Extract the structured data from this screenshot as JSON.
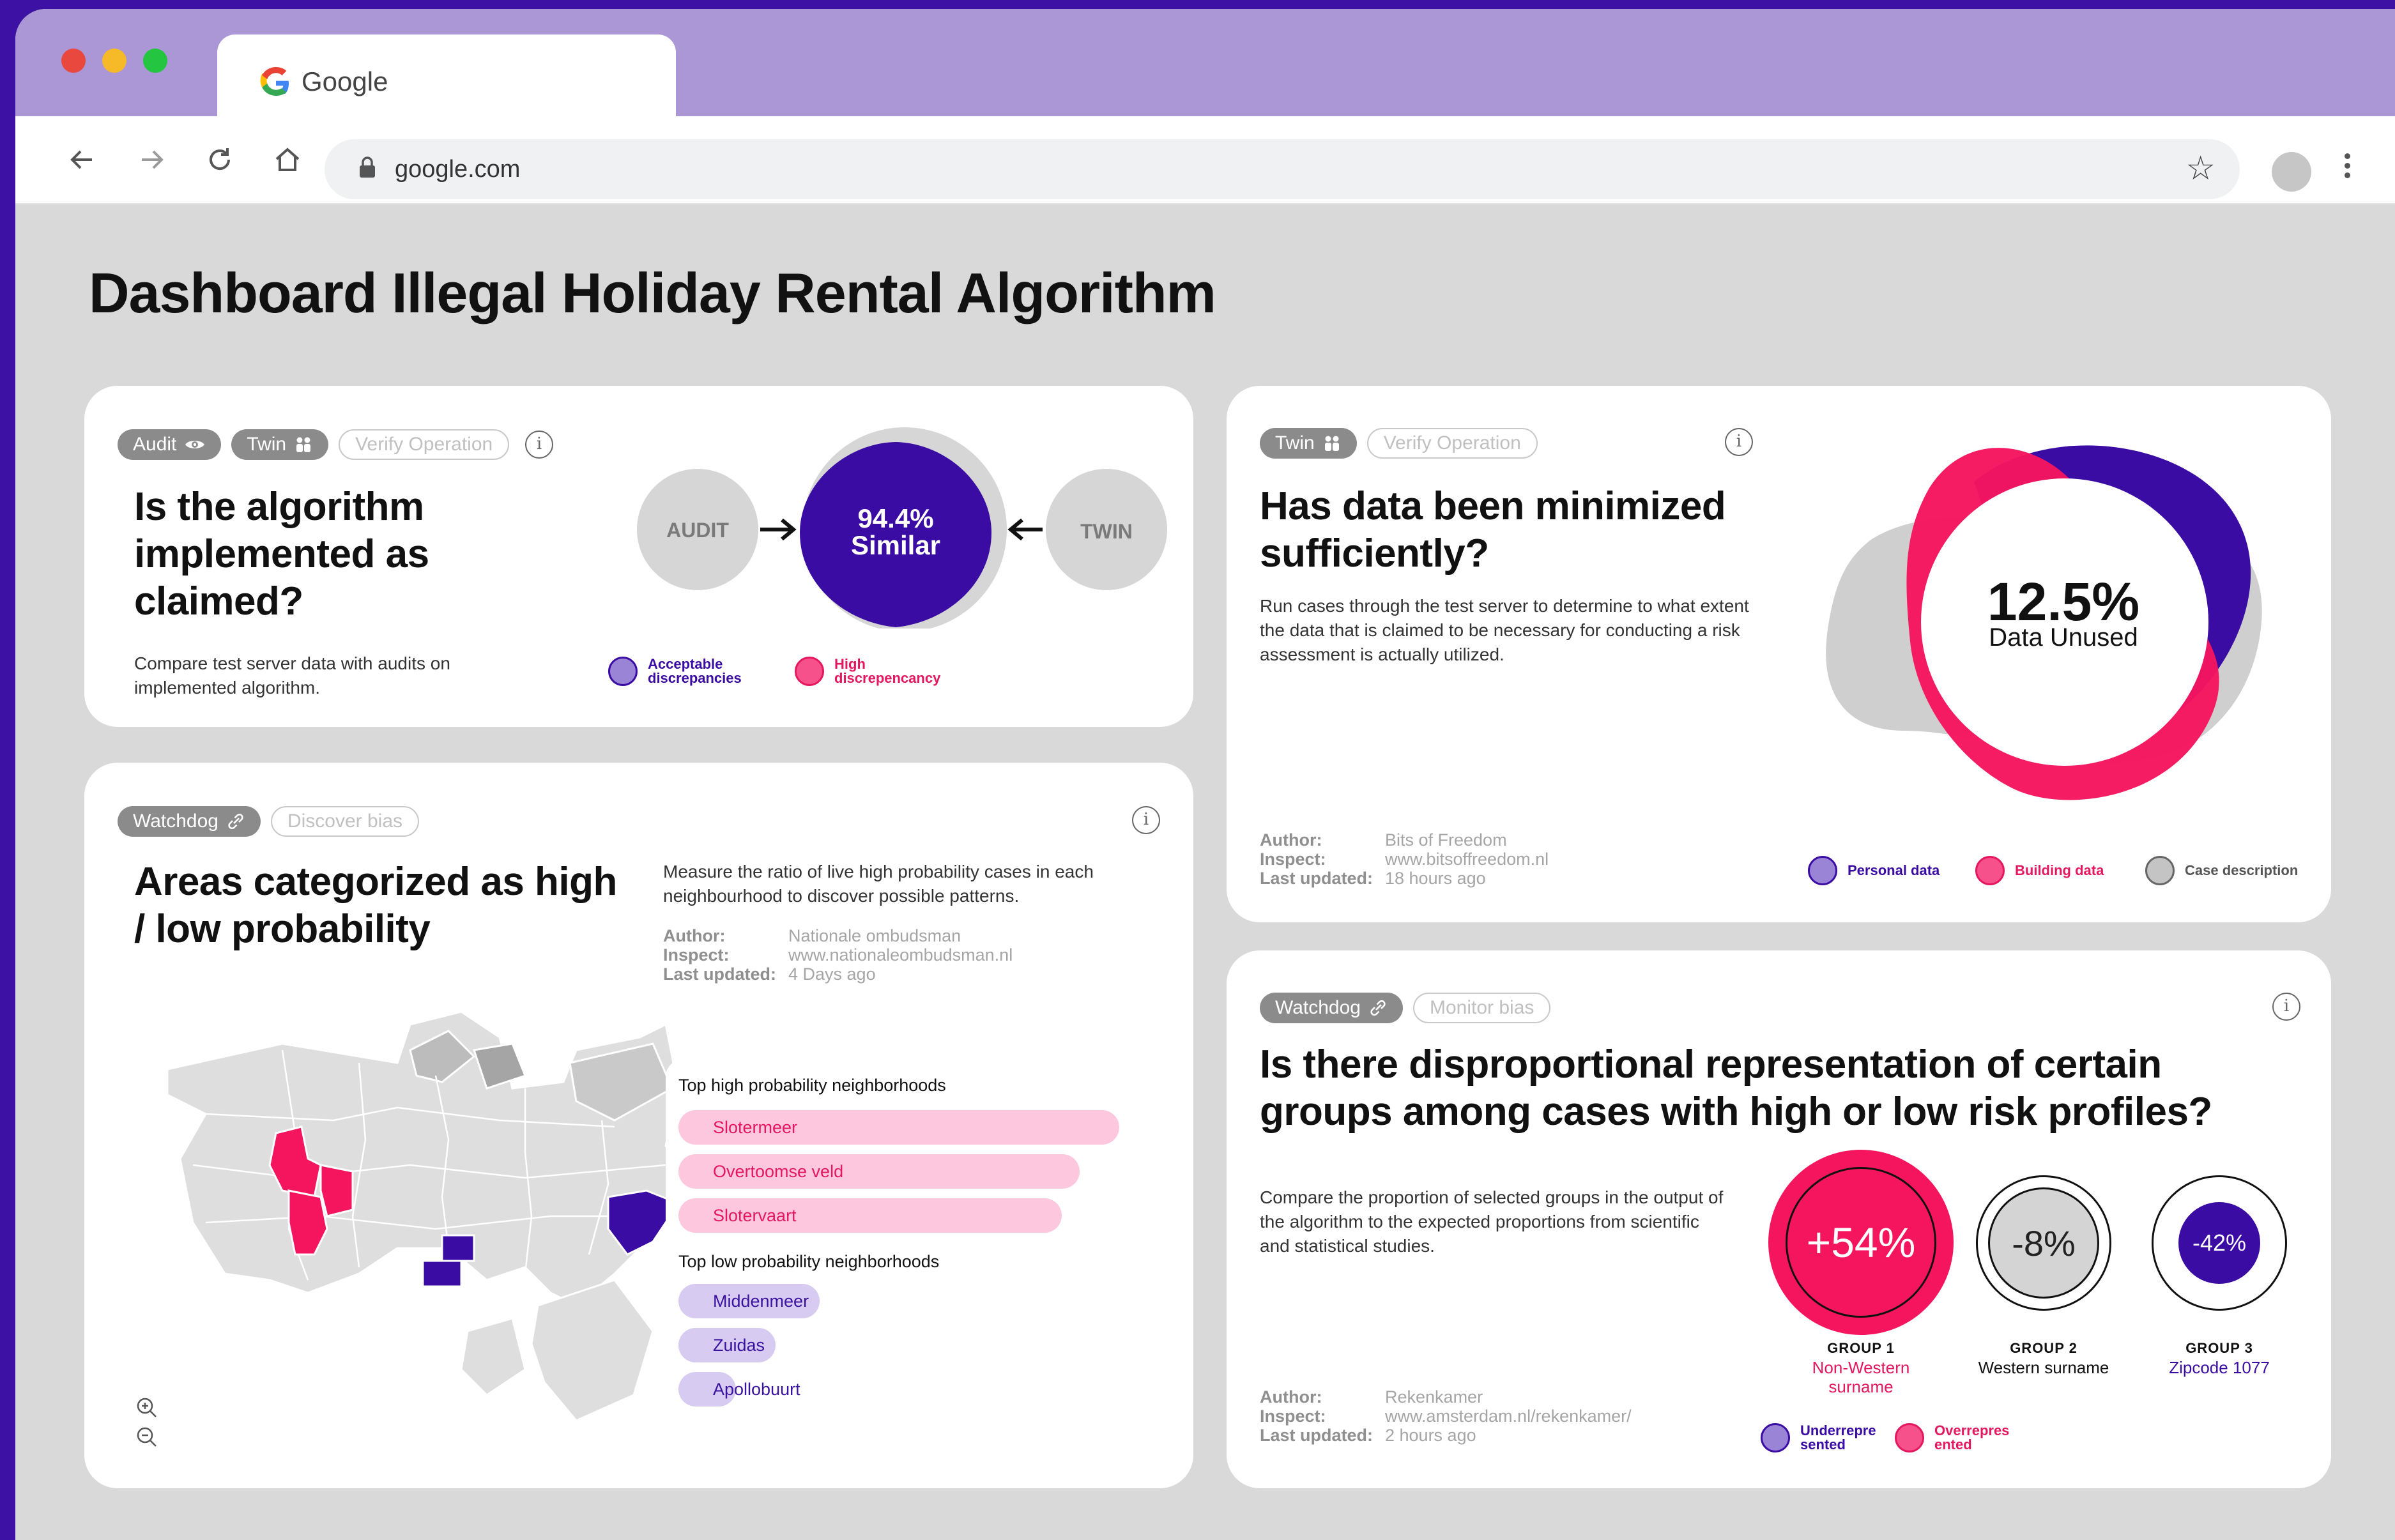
{
  "browser": {
    "tab_title": "Google",
    "tab_logo": "G",
    "url": "google.com",
    "icons": [
      "back-icon",
      "forward-icon",
      "reload-icon",
      "home-icon",
      "lock-icon",
      "star-icon",
      "profile-avatar",
      "more-icon"
    ],
    "colors": {
      "titlebar": "#ab96d6",
      "close": "#e9483f",
      "minimize": "#f6b928",
      "maximize": "#23c541"
    }
  },
  "page": {
    "title": "Dashboard Illegal Holiday Rental Algorithm"
  },
  "card1": {
    "tags": [
      "Audit",
      "Twin",
      "Verify Operation"
    ],
    "title": "Is the algorithm implemented as claimed?",
    "description": "Compare test server data with audits on implemented algorithm.",
    "audit_label": "AUDIT",
    "twin_label": "TWIN",
    "similar_value": "94.4%",
    "similar_label": "Similar",
    "legend": [
      {
        "label": "Acceptable discrepancies",
        "color": "#9a84d6"
      },
      {
        "label": "High discrepencancy",
        "color": "#f6518a"
      }
    ]
  },
  "card2": {
    "tags": [
      "Twin",
      "Verify Operation"
    ],
    "title": "Has data been minimized sufficiently?",
    "description": "Run cases through the test server to determine to what extent the data that is claimed to be necessary for conducting a risk assessment is actually utilized.",
    "value": "12.5%",
    "value_label": "Data Unused",
    "meta": {
      "author_k": "Author:",
      "author_v": "Bits of Freedom",
      "inspect_k": "Inspect:",
      "inspect_v": "www.bitsoffreedom.nl",
      "updated_k": "Last updated:",
      "updated_v": "18 hours ago"
    },
    "legend": [
      {
        "label": "Personal data",
        "color": "#9a84d6"
      },
      {
        "label": "Building data",
        "color": "#f6518a"
      },
      {
        "label": "Case description",
        "color": "#c4c4c4"
      }
    ]
  },
  "card3": {
    "tags": [
      "Watchdog",
      "Discover bias"
    ],
    "title": "Areas categorized as high / low probability",
    "description": "Measure the ratio of live high probability cases in each neighbourhood to discover possible patterns.",
    "meta": {
      "author_k": "Author:",
      "author_v": "Nationale ombudsman",
      "inspect_k": "Inspect:",
      "inspect_v": "www.nationaleombudsman.nl",
      "updated_k": "Last updated:",
      "updated_v": "4 Days ago"
    },
    "high_heading": "Top high probability neighborhoods",
    "high": [
      {
        "name": "Slotermeer",
        "share": 1.0
      },
      {
        "name": "Overtoomse veld",
        "share": 0.91
      },
      {
        "name": "Slotervaart",
        "share": 0.87
      }
    ],
    "low_heading": "Top low probability neighborhoods",
    "low": [
      {
        "name": "Middenmeer",
        "share": 0.32
      },
      {
        "name": "Zuidas",
        "share": 0.22
      },
      {
        "name": "Apollobuurt",
        "share": 0.13
      }
    ],
    "zoom_in": "+",
    "zoom_out": "−"
  },
  "card4": {
    "tags": [
      "Watchdog",
      "Monitor bias"
    ],
    "title": "Is there disproportional representation of certain groups among cases with high or low risk profiles?",
    "description": "Compare the proportion of selected groups in the output of the algorithm to the expected proportions from scientific and statistical studies.",
    "meta": {
      "author_k": "Author:",
      "author_v": "Rekenkamer",
      "inspect_k": "Inspect:",
      "inspect_v": "www.amsterdam.nl/rekenkamer/",
      "updated_k": "Last updated:",
      "updated_v": "2 hours ago"
    },
    "groups": [
      {
        "value": "+54%",
        "name": "GROUP 1",
        "label": "Non-Western surname",
        "color": "#f5155f"
      },
      {
        "value": "-8%",
        "name": "GROUP 2",
        "label": "Western surname",
        "color": "#d4d4d4"
      },
      {
        "value": "-42%",
        "name": "GROUP 3",
        "label": "Zipcode 1077",
        "color": "#3a0ca3"
      }
    ],
    "legend": [
      {
        "label": "Underrepresented",
        "color": "#9a84d6"
      },
      {
        "label": "Overrepresented",
        "color": "#f6518a"
      }
    ]
  }
}
